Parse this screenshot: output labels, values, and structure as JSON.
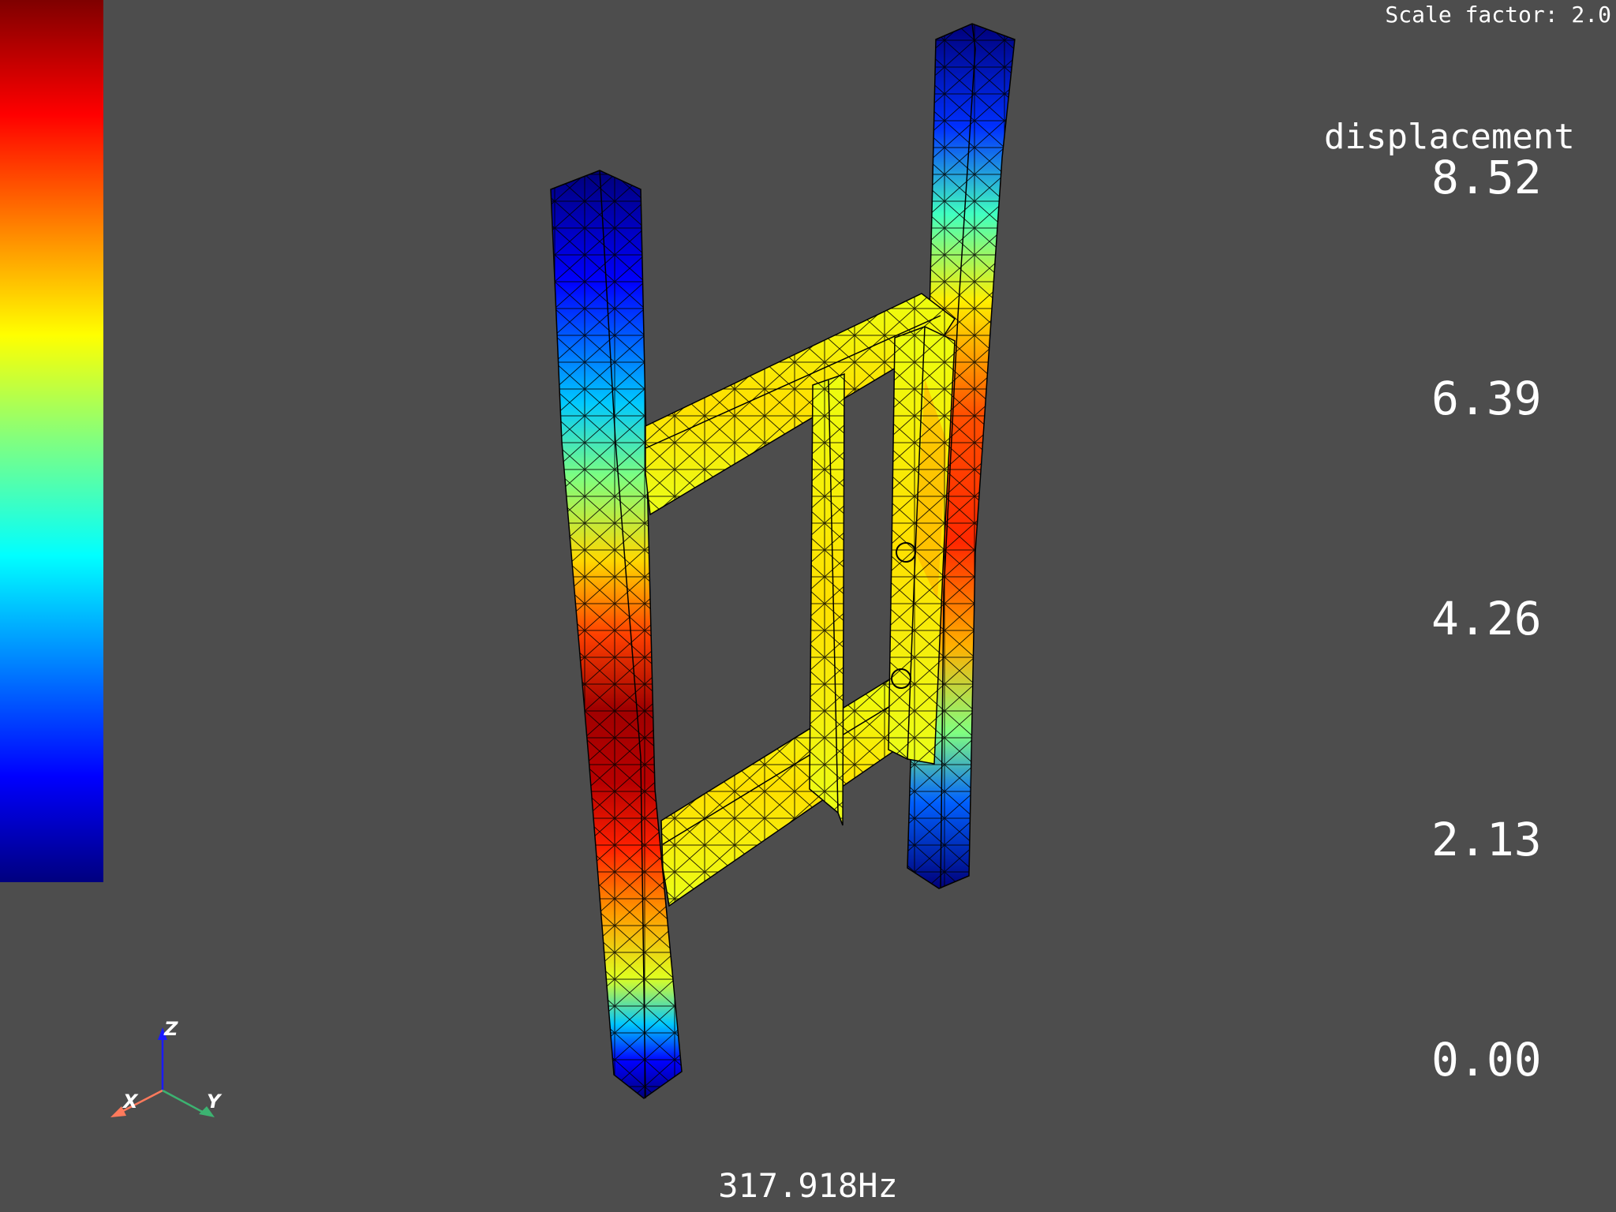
{
  "viewer": {
    "scale_factor_text": "Scale factor: 2.0",
    "frequency_text": "317.918Hz",
    "background": "#4d4d4d"
  },
  "legend": {
    "title": "displacement",
    "ticks": [
      "8.52",
      "6.39",
      "4.26",
      "2.13",
      "0.00"
    ],
    "min": 0.0,
    "max": 8.52,
    "colormap": "jet",
    "colors": [
      "#000080",
      "#0000ff",
      "#00ffff",
      "#ffff00",
      "#ff0000",
      "#800000"
    ]
  },
  "orientation_axes": {
    "x": {
      "label": "X",
      "color": "#ff7a5c"
    },
    "y": {
      "label": "Y",
      "color": "#3cb371"
    },
    "z": {
      "label": "Z",
      "color": "#1a1aff"
    }
  },
  "model": {
    "description_icon": "ladder-frame-mesh",
    "mesh_color": "#000000"
  }
}
